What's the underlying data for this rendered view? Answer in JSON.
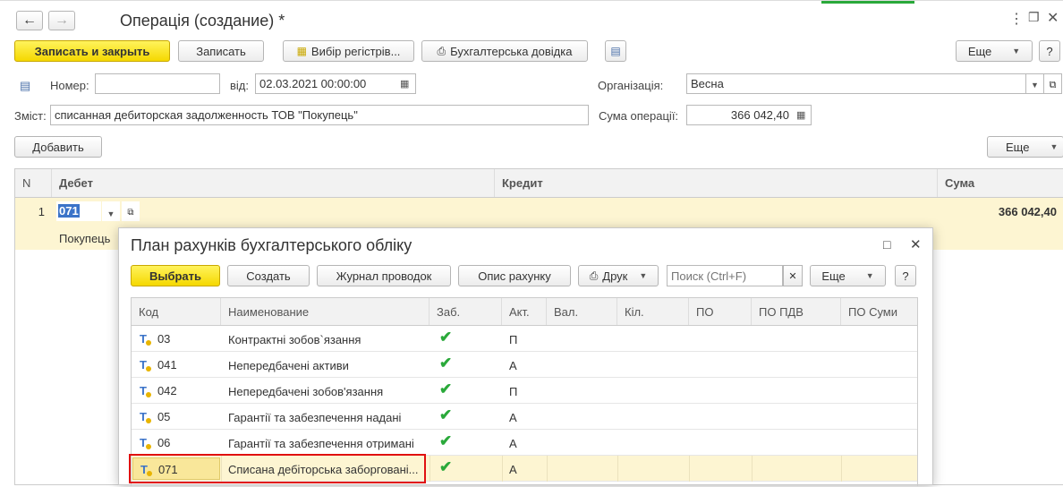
{
  "window": {
    "title": "Операція (создание) *"
  },
  "toolbar": {
    "save_close": "Записать и закрыть",
    "save": "Записать",
    "registers": "Вибір регістрів...",
    "reference": "Бухгалтерська довідка",
    "more": "Еще",
    "help": "?"
  },
  "form": {
    "number_label": "Номер:",
    "number_value": "",
    "date_label": "від:",
    "date_value": "02.03.2021 00:00:00",
    "org_label": "Організація:",
    "org_value": "Весна",
    "content_label": "Зміст:",
    "content_value": "списанная дебиторская задолженность ТОВ \"Покупець\"",
    "sum_label": "Сума операції:",
    "sum_value": "366 042,40"
  },
  "grid_toolbar": {
    "add": "Добавить",
    "more": "Еще"
  },
  "grid": {
    "headers": {
      "n": "N",
      "debit": "Дебет",
      "credit": "Кредит",
      "sum": "Сума"
    },
    "row": {
      "n": "1",
      "debit_account": "071",
      "debit_sub": "Покупець",
      "sum": "366 042,40"
    }
  },
  "dialog": {
    "title": "План рахунків бухгалтерського обліку",
    "buttons": {
      "select": "Выбрать",
      "create": "Создать",
      "journal": "Журнал проводок",
      "describe": "Опис рахунку",
      "print": "Друк",
      "more": "Еще",
      "help": "?"
    },
    "search_placeholder": "Поиск (Ctrl+F)",
    "columns": [
      "Код",
      "Наименование",
      "Заб.",
      "Акт.",
      "Вал.",
      "Кіл.",
      "ПО",
      "ПО ПДВ",
      "ПО Суми"
    ],
    "rows": [
      {
        "code": "03",
        "name": "Контрактні зобов`язання",
        "off_balance": true,
        "type": "П"
      },
      {
        "code": "041",
        "name": "Непередбачені активи",
        "off_balance": true,
        "type": "А"
      },
      {
        "code": "042",
        "name": "Непередбачені  зобов'язання",
        "off_balance": true,
        "type": "П"
      },
      {
        "code": "05",
        "name": "Гарантії та забезпечення надані",
        "off_balance": true,
        "type": "А"
      },
      {
        "code": "06",
        "name": "Гарантії та забезпечення отримані",
        "off_balance": true,
        "type": "А"
      },
      {
        "code": "071",
        "name": "Списана дебіторська заборговані...",
        "off_balance": true,
        "type": "А"
      }
    ],
    "selected_index": 5
  },
  "colors": {
    "accent_yellow": "#f5d800",
    "row_highlight": "#fdf5d2",
    "selection_border": "#e01010",
    "check_green": "#2aa93a"
  }
}
